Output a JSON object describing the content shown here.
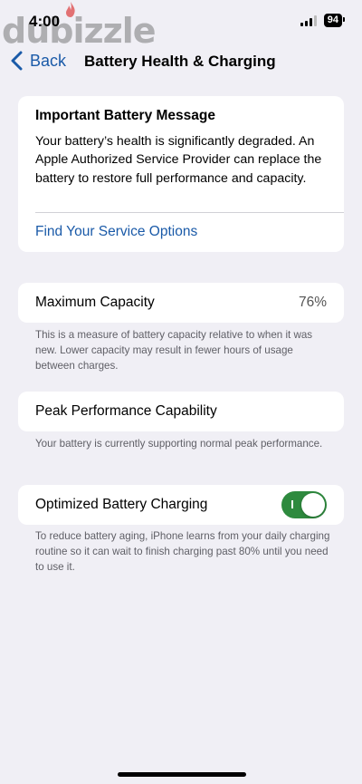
{
  "status_bar": {
    "time": "4:00",
    "battery_level": "94",
    "signal_bars": 3,
    "watermark": "dubizzle"
  },
  "nav": {
    "back_label": "Back",
    "title": "Battery Health & Charging"
  },
  "message_card": {
    "title": "Important Battery Message",
    "body": "Your battery’s health is significantly degraded. An Apple Authorized Service Provider can replace the battery to restore full performance and capacity.",
    "link": "Find Your Service Options"
  },
  "maximum_capacity": {
    "label": "Maximum Capacity",
    "value": "76%",
    "footnote": "This is a measure of battery capacity relative to when it was new. Lower capacity may result in fewer hours of usage between charges."
  },
  "peak_performance": {
    "label": "Peak Performance Capability",
    "footnote": "Your battery is currently supporting normal peak performance."
  },
  "optimized_charging": {
    "label": "Optimized Battery Charging",
    "enabled": true,
    "footnote": "To reduce battery aging, iPhone learns from your daily charging routine so it can wait to finish charging past 80% until you need to use it."
  },
  "colors": {
    "accent": "#1a5aa8",
    "toggle_on": "#2e8a3e",
    "background": "#f0eff5"
  }
}
